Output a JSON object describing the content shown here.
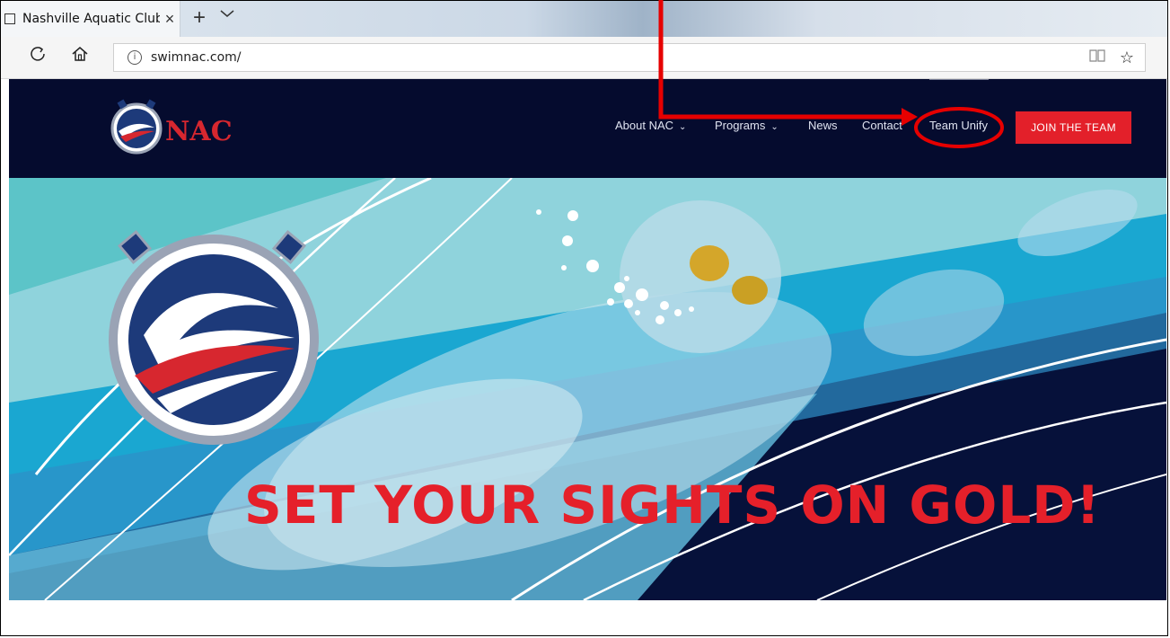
{
  "browser": {
    "tab_title": "Nashville Aquatic Club - ",
    "tab_close": "×",
    "new_tab": "+",
    "tab_menu": "⌵",
    "url": "swimnac.com/"
  },
  "site": {
    "logo_text": "NAC",
    "nav": [
      {
        "label": "About NAC",
        "dropdown": true
      },
      {
        "label": "Programs",
        "dropdown": true
      },
      {
        "label": "News",
        "dropdown": false
      },
      {
        "label": "Contact",
        "dropdown": false
      },
      {
        "label": "Team Unify",
        "dropdown": false
      }
    ],
    "cta_label": "JOIN THE TEAM",
    "hero_headline": "SET YOUR SIGHTS ON GOLD!"
  },
  "colors": {
    "header_bg": "#050b2e",
    "accent_red": "#e3202a",
    "annotation_red": "#e60000"
  },
  "icons": {
    "refresh": "refresh-icon",
    "home": "home-icon",
    "info": "info-icon",
    "reading_view": "reading-view-icon",
    "favorite": "star-icon"
  }
}
